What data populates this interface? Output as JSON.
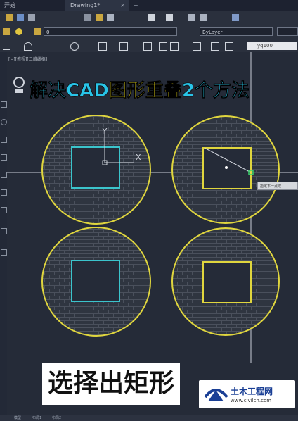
{
  "tabs": {
    "start": "开始",
    "drawing": "Drawing1*",
    "close": "×",
    "add": "+"
  },
  "toolbar": {
    "layer_value": "0",
    "bylayer": "ByLayer"
  },
  "command": {
    "input": "yq100"
  },
  "viewport": {
    "label": "[−][俯视][二维线框]"
  },
  "title": {
    "part1": "解决CAD",
    "part2": "图形重叠",
    "part3": "2个方法"
  },
  "ucs": {
    "y": "Y",
    "x": "X"
  },
  "tooltip": {
    "text": "指定下一点或"
  },
  "caption": {
    "text": "选择出矩形"
  },
  "watermark": {
    "brand": "土木工程网",
    "url": "www.civilcn.com"
  },
  "status": {
    "model": "模型",
    "layout1": "布局1",
    "layout2": "布局2"
  },
  "colors": {
    "yellow": "#e0d63e",
    "cyan": "#3bc4cc",
    "title_cyan": "#29c4e8",
    "title_yellow": "#f2e21a"
  }
}
